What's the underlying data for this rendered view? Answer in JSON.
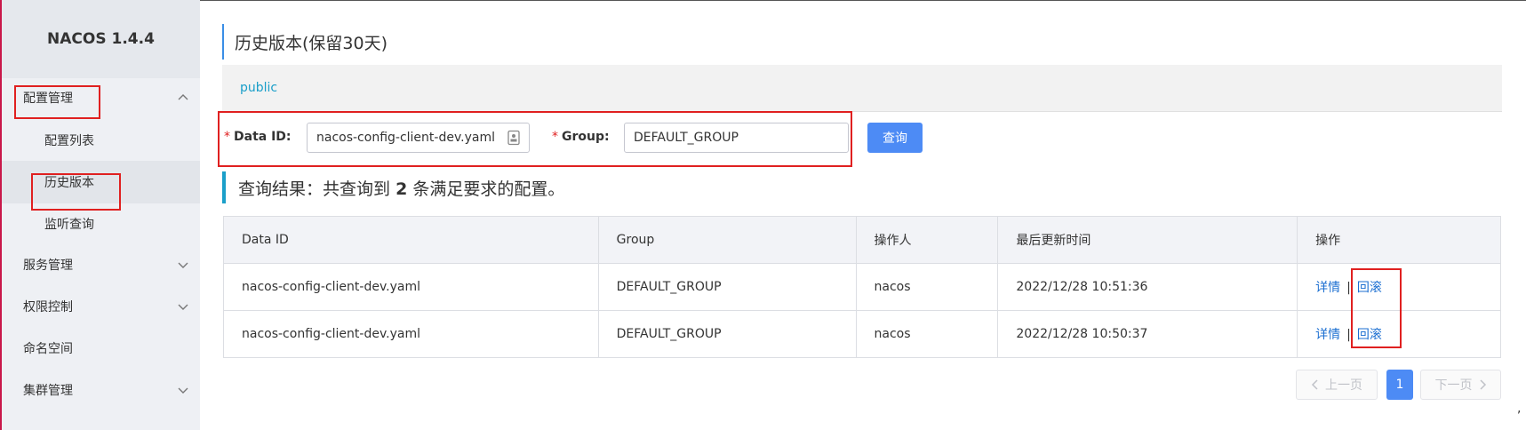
{
  "app": {
    "title": "NACOS 1.4.4"
  },
  "sidebar": {
    "config": {
      "label": "配置管理",
      "items": [
        {
          "label": "配置列表"
        },
        {
          "label": "历史版本"
        },
        {
          "label": "监听查询"
        }
      ]
    },
    "service": {
      "label": "服务管理"
    },
    "auth": {
      "label": "权限控制"
    },
    "namespace": {
      "label": "命名空间"
    },
    "cluster": {
      "label": "集群管理"
    }
  },
  "page": {
    "title": "历史版本(保留30天)",
    "namespace": "public"
  },
  "form": {
    "dataid_label": "Data ID:",
    "dataid_value": "nacos-config-client-dev.yaml",
    "group_label": "Group:",
    "group_value": "DEFAULT_GROUP",
    "required_mark": "*",
    "query_label": "查询"
  },
  "result": {
    "prefix": "查询结果：共查询到",
    "count": "2",
    "suffix": "条满足要求的配置。"
  },
  "table": {
    "headers": {
      "dataid": "Data ID",
      "group": "Group",
      "operator": "操作人",
      "updated": "最后更新时间",
      "actions": "操作"
    },
    "rows": [
      {
        "dataid": "nacos-config-client-dev.yaml",
        "group": "DEFAULT_GROUP",
        "operator": "nacos",
        "updated": "2022/12/28 10:51:36",
        "detail": "详情",
        "sep": "|",
        "rollback": "回滚"
      },
      {
        "dataid": "nacos-config-client-dev.yaml",
        "group": "DEFAULT_GROUP",
        "operator": "nacos",
        "updated": "2022/12/28 10:50:37",
        "detail": "详情",
        "sep": "|",
        "rollback": "回滚"
      }
    ]
  },
  "pagination": {
    "prev": "上一页",
    "current": "1",
    "next": "下一页"
  },
  "misc": {
    "trailing_mark": ","
  },
  "colors": {
    "accent": "#4d8bf5",
    "link": "#1c6fd1",
    "highlight": "#e02020"
  },
  "icons": {
    "chevron_up": "chevron-up-icon",
    "chevron_down": "chevron-down-icon",
    "picker": "id-card-icon"
  }
}
